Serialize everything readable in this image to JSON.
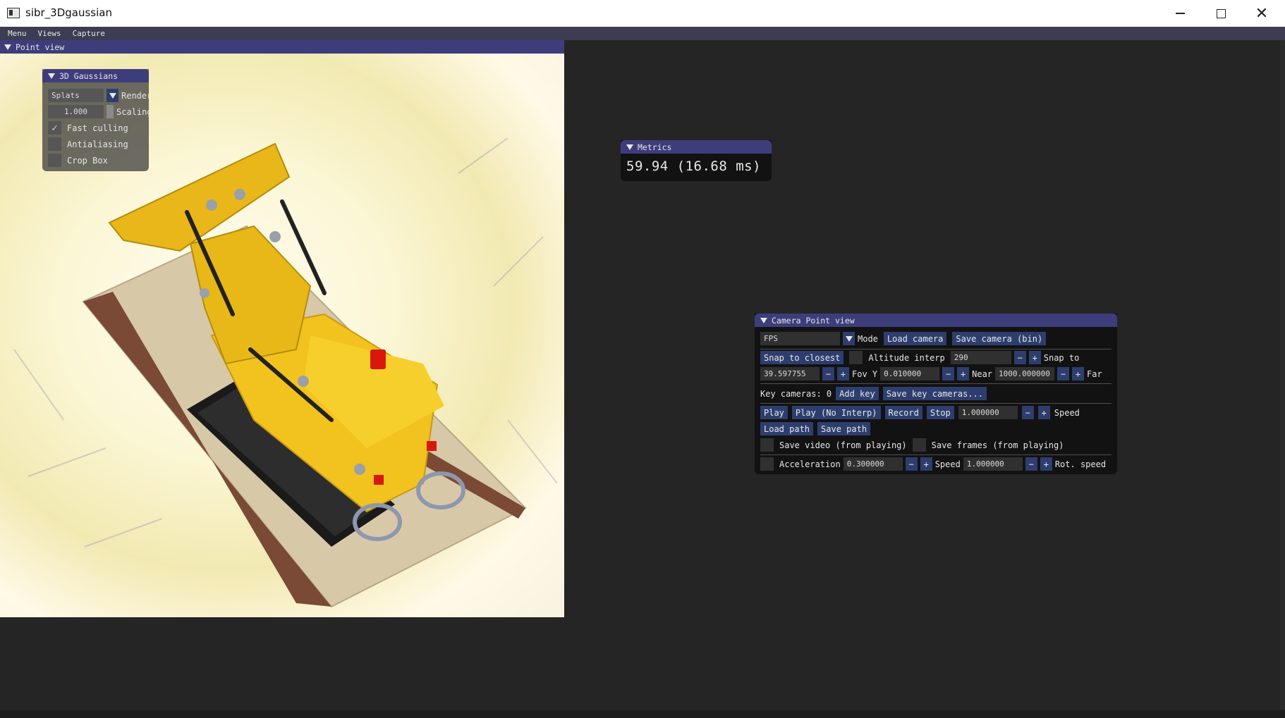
{
  "window": {
    "title": "sibr_3Dgaussian",
    "minimize": "—",
    "maximize": "□",
    "close": "✕"
  },
  "menubar": {
    "items": [
      "Menu",
      "Views",
      "Capture"
    ]
  },
  "point_view": {
    "title": "Point view"
  },
  "gaussians_panel": {
    "title": "3D Gaussians",
    "render_mode": "Splats",
    "render_label": "Render",
    "scaling_value": "1.000",
    "scaling_label": "Scaling",
    "fast_culling": {
      "label": "Fast culling",
      "checked": true
    },
    "antialiasing": {
      "label": "Antialiasing",
      "checked": false
    },
    "crop_box": {
      "label": "Crop Box",
      "checked": false
    }
  },
  "metrics": {
    "title": "Metrics",
    "value": "59.94 (16.68 ms)"
  },
  "camera_panel": {
    "title": "Camera Point view",
    "mode_value": "FPS",
    "mode_label": "Mode",
    "load_camera": "Load camera",
    "save_camera": "Save camera (bin)",
    "snap_to_closest": "Snap to closest",
    "altitude_interp_label": "Altitude interp",
    "altitude_value": "290",
    "snap_to_label": "Snap to",
    "fov_value": "39.597755",
    "fov_label": "Fov Y",
    "near_value": "0.010000",
    "near_label": "Near",
    "far_value": "1000.000000",
    "far_label": "Far",
    "key_cameras_label": "Key cameras: 0",
    "add_key": "Add key",
    "save_key_cameras": "Save key cameras...",
    "play": "Play",
    "play_no_interp": "Play (No Interp)",
    "record": "Record",
    "stop": "Stop",
    "playback_speed_value": "1.000000",
    "playback_speed_label": "Speed",
    "load_path": "Load path",
    "save_path": "Save path",
    "save_video": "Save video (from playing)",
    "save_frames": "Save frames (from playing)",
    "acceleration_label": "Acceleration",
    "acceleration_value": "0.300000",
    "speed_label": "Speed",
    "speed_value": "1.000000",
    "rot_speed_label": "Rot. speed",
    "minus": "−",
    "plus": "+"
  },
  "colors": {
    "title_active": "#3d3d7c",
    "button": "#2d3e6e",
    "background": "#252525",
    "panel_bg": "#121212"
  }
}
